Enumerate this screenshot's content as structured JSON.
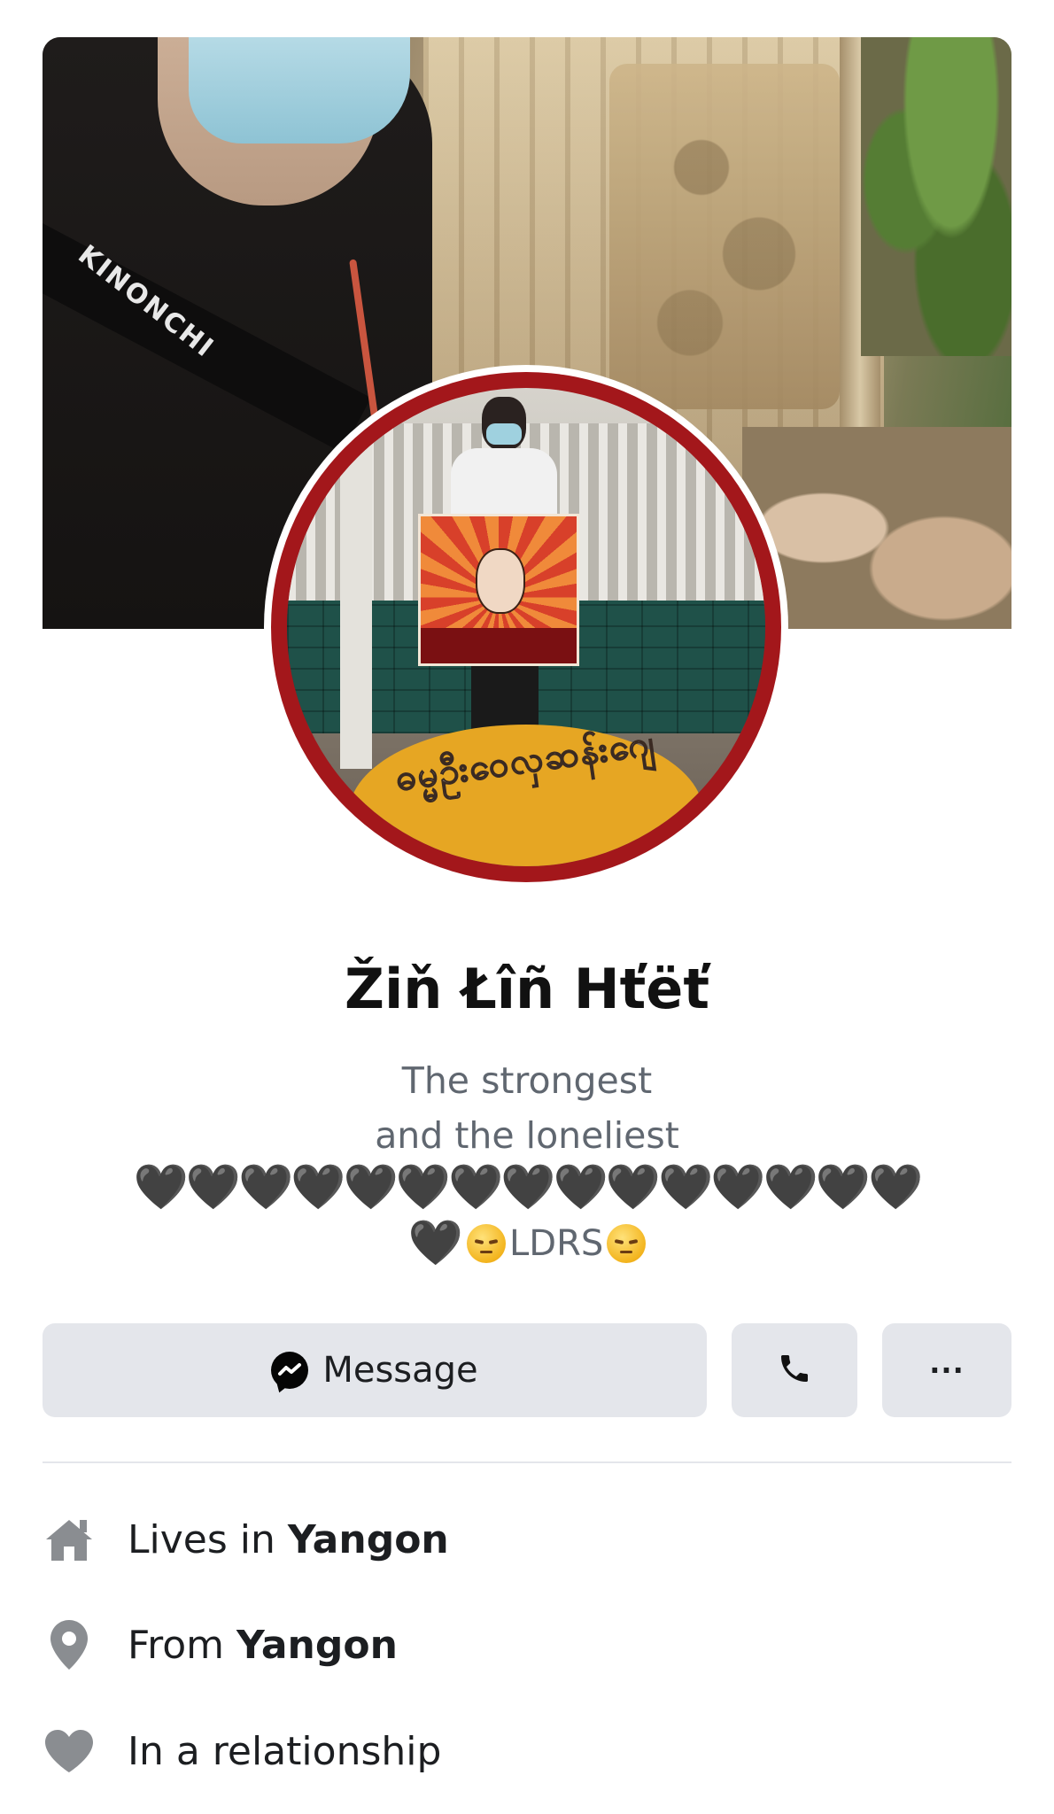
{
  "cover": {
    "strap_text": "KINONCHI"
  },
  "profile_picture": {
    "overlay_script": "ဓမ္မဦးဝေလှဆန်းဂျေ"
  },
  "profile": {
    "name": "Žiň Łîñ Hťëť",
    "bio_line1": "The strongest",
    "bio_line2": "and the loneliest",
    "bio_hearts": "🖤🖤🖤🖤🖤🖤🖤🖤🖤🖤🖤🖤🖤🖤🖤",
    "bio_last_heart": "🖤",
    "bio_last_text": "LDRS"
  },
  "actions": {
    "message_label": "Message",
    "call_icon": "phone-icon",
    "more_label": "..."
  },
  "intro": {
    "items": [
      {
        "icon": "home-icon",
        "prefix": "Lives in ",
        "value": "Yangon"
      },
      {
        "icon": "location-pin-icon",
        "prefix": "From ",
        "value": "Yangon"
      },
      {
        "icon": "heart-icon",
        "prefix": "In a relationship",
        "value": ""
      }
    ]
  },
  "colors": {
    "button_bg": "#e4e6eb",
    "avatar_frame": "#a3171b",
    "secondary_text": "#606770",
    "icon_gray": "#8a8d91"
  }
}
